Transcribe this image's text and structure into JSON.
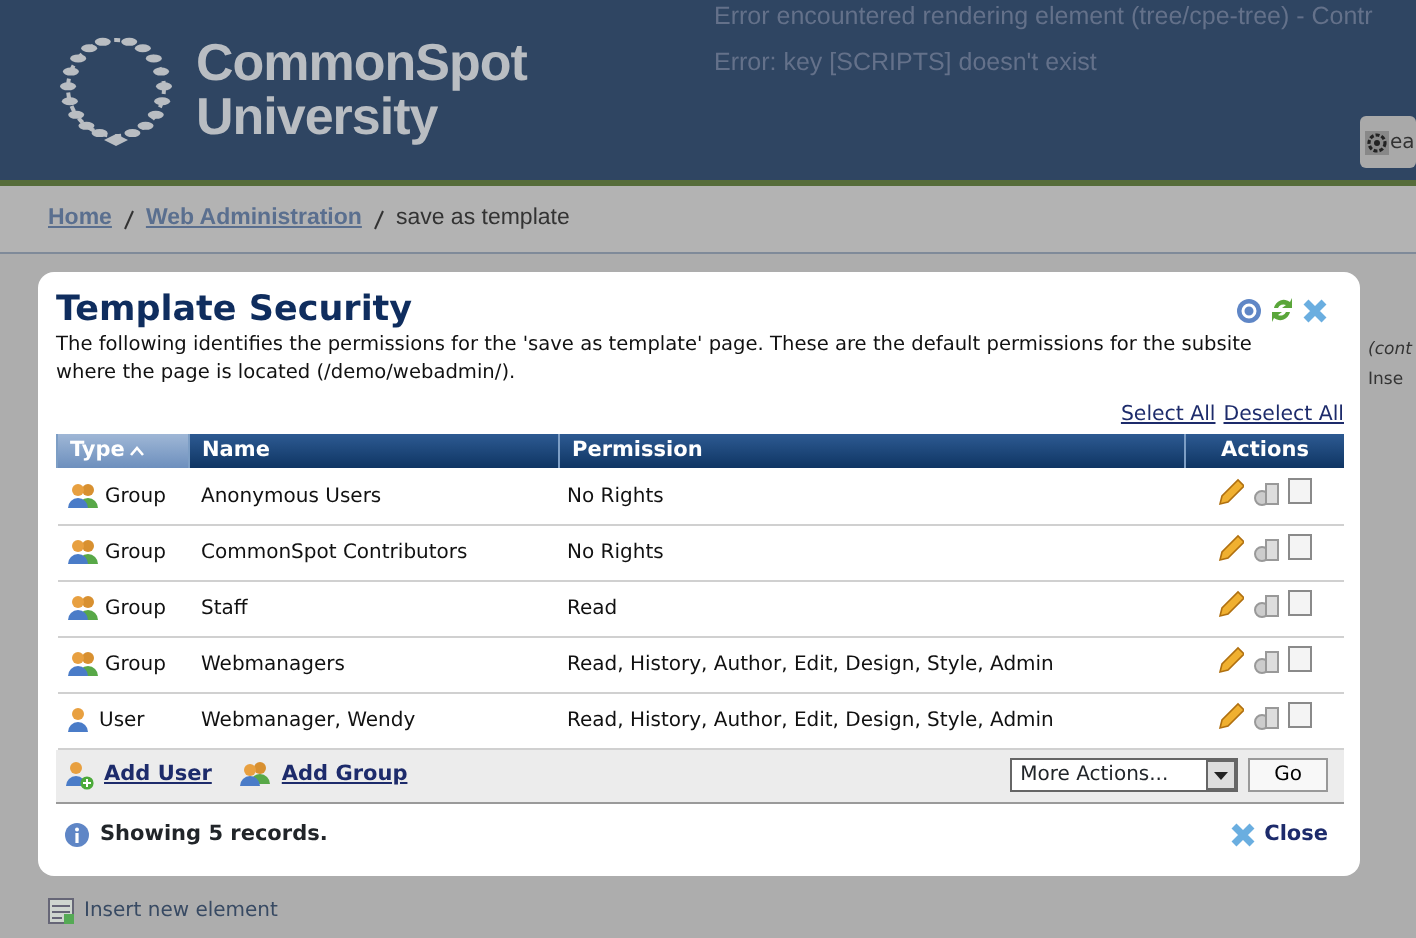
{
  "header": {
    "logo_line1": "CommonSpot",
    "logo_line2": "University",
    "errors": [
      "Error encountered rendering element (tree/cpe-tree) - Contr",
      "Error: key [SCRIPTS] doesn't exist"
    ],
    "search": {
      "value": "ea"
    }
  },
  "breadcrumb": [
    {
      "label": "Home",
      "link": true
    },
    {
      "label": "Web Administration",
      "link": true
    },
    {
      "label": "save as template",
      "link": false
    }
  ],
  "background": {
    "element_note": "(cont",
    "insert_short": "Inse",
    "insert_element": "Insert new element"
  },
  "dialog": {
    "title": "Template Security",
    "description": "The following identifies the permissions for the 'save as template' page. These are the default permissions for the subsite where the page is located (/demo/webadmin/).",
    "select_all": "Select All",
    "deselect_all": "Deselect All",
    "columns": [
      {
        "label": "Type",
        "sorted": true
      },
      {
        "label": "Name",
        "sorted": false
      },
      {
        "label": "Permission",
        "sorted": false
      },
      {
        "label": "Actions",
        "sorted": false
      }
    ],
    "rows": [
      {
        "type": "Group",
        "name": "Anonymous Users",
        "permission": "No Rights",
        "checked": false
      },
      {
        "type": "Group",
        "name": "CommonSpot Contributors",
        "permission": "No Rights",
        "checked": false
      },
      {
        "type": "Group",
        "name": "Staff",
        "permission": "Read",
        "checked": false
      },
      {
        "type": "Group",
        "name": "Webmanagers",
        "permission": "Read, History, Author, Edit, Design, Style, Admin",
        "checked": false
      },
      {
        "type": "User",
        "name": "Webmanager, Wendy",
        "permission": "Read, History, Author, Edit, Design, Style, Admin",
        "checked": false
      }
    ],
    "add_user": "Add User",
    "add_group": "Add Group",
    "more_actions": "More Actions...",
    "go": "Go",
    "status": "Showing 5 records.",
    "close": "Close"
  }
}
